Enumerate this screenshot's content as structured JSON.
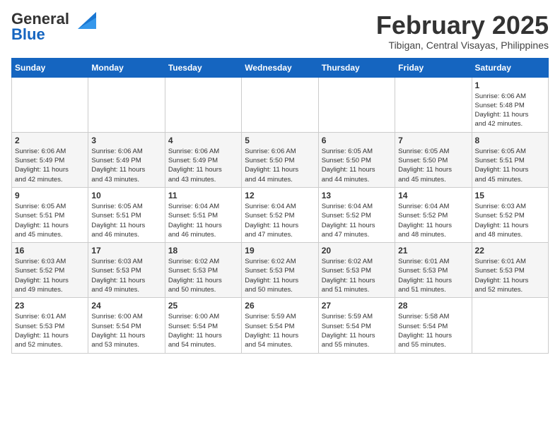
{
  "header": {
    "logo_general": "General",
    "logo_blue": "Blue",
    "month_title": "February 2025",
    "location": "Tibigan, Central Visayas, Philippines"
  },
  "weekdays": [
    "Sunday",
    "Monday",
    "Tuesday",
    "Wednesday",
    "Thursday",
    "Friday",
    "Saturday"
  ],
  "weeks": [
    [
      {
        "day": "",
        "info": ""
      },
      {
        "day": "",
        "info": ""
      },
      {
        "day": "",
        "info": ""
      },
      {
        "day": "",
        "info": ""
      },
      {
        "day": "",
        "info": ""
      },
      {
        "day": "",
        "info": ""
      },
      {
        "day": "1",
        "info": "Sunrise: 6:06 AM\nSunset: 5:48 PM\nDaylight: 11 hours\nand 42 minutes."
      }
    ],
    [
      {
        "day": "2",
        "info": "Sunrise: 6:06 AM\nSunset: 5:49 PM\nDaylight: 11 hours\nand 42 minutes."
      },
      {
        "day": "3",
        "info": "Sunrise: 6:06 AM\nSunset: 5:49 PM\nDaylight: 11 hours\nand 43 minutes."
      },
      {
        "day": "4",
        "info": "Sunrise: 6:06 AM\nSunset: 5:49 PM\nDaylight: 11 hours\nand 43 minutes."
      },
      {
        "day": "5",
        "info": "Sunrise: 6:06 AM\nSunset: 5:50 PM\nDaylight: 11 hours\nand 44 minutes."
      },
      {
        "day": "6",
        "info": "Sunrise: 6:05 AM\nSunset: 5:50 PM\nDaylight: 11 hours\nand 44 minutes."
      },
      {
        "day": "7",
        "info": "Sunrise: 6:05 AM\nSunset: 5:50 PM\nDaylight: 11 hours\nand 45 minutes."
      },
      {
        "day": "8",
        "info": "Sunrise: 6:05 AM\nSunset: 5:51 PM\nDaylight: 11 hours\nand 45 minutes."
      }
    ],
    [
      {
        "day": "9",
        "info": "Sunrise: 6:05 AM\nSunset: 5:51 PM\nDaylight: 11 hours\nand 45 minutes."
      },
      {
        "day": "10",
        "info": "Sunrise: 6:05 AM\nSunset: 5:51 PM\nDaylight: 11 hours\nand 46 minutes."
      },
      {
        "day": "11",
        "info": "Sunrise: 6:04 AM\nSunset: 5:51 PM\nDaylight: 11 hours\nand 46 minutes."
      },
      {
        "day": "12",
        "info": "Sunrise: 6:04 AM\nSunset: 5:52 PM\nDaylight: 11 hours\nand 47 minutes."
      },
      {
        "day": "13",
        "info": "Sunrise: 6:04 AM\nSunset: 5:52 PM\nDaylight: 11 hours\nand 47 minutes."
      },
      {
        "day": "14",
        "info": "Sunrise: 6:04 AM\nSunset: 5:52 PM\nDaylight: 11 hours\nand 48 minutes."
      },
      {
        "day": "15",
        "info": "Sunrise: 6:03 AM\nSunset: 5:52 PM\nDaylight: 11 hours\nand 48 minutes."
      }
    ],
    [
      {
        "day": "16",
        "info": "Sunrise: 6:03 AM\nSunset: 5:52 PM\nDaylight: 11 hours\nand 49 minutes."
      },
      {
        "day": "17",
        "info": "Sunrise: 6:03 AM\nSunset: 5:53 PM\nDaylight: 11 hours\nand 49 minutes."
      },
      {
        "day": "18",
        "info": "Sunrise: 6:02 AM\nSunset: 5:53 PM\nDaylight: 11 hours\nand 50 minutes."
      },
      {
        "day": "19",
        "info": "Sunrise: 6:02 AM\nSunset: 5:53 PM\nDaylight: 11 hours\nand 50 minutes."
      },
      {
        "day": "20",
        "info": "Sunrise: 6:02 AM\nSunset: 5:53 PM\nDaylight: 11 hours\nand 51 minutes."
      },
      {
        "day": "21",
        "info": "Sunrise: 6:01 AM\nSunset: 5:53 PM\nDaylight: 11 hours\nand 51 minutes."
      },
      {
        "day": "22",
        "info": "Sunrise: 6:01 AM\nSunset: 5:53 PM\nDaylight: 11 hours\nand 52 minutes."
      }
    ],
    [
      {
        "day": "23",
        "info": "Sunrise: 6:01 AM\nSunset: 5:53 PM\nDaylight: 11 hours\nand 52 minutes."
      },
      {
        "day": "24",
        "info": "Sunrise: 6:00 AM\nSunset: 5:54 PM\nDaylight: 11 hours\nand 53 minutes."
      },
      {
        "day": "25",
        "info": "Sunrise: 6:00 AM\nSunset: 5:54 PM\nDaylight: 11 hours\nand 54 minutes."
      },
      {
        "day": "26",
        "info": "Sunrise: 5:59 AM\nSunset: 5:54 PM\nDaylight: 11 hours\nand 54 minutes."
      },
      {
        "day": "27",
        "info": "Sunrise: 5:59 AM\nSunset: 5:54 PM\nDaylight: 11 hours\nand 55 minutes."
      },
      {
        "day": "28",
        "info": "Sunrise: 5:58 AM\nSunset: 5:54 PM\nDaylight: 11 hours\nand 55 minutes."
      },
      {
        "day": "",
        "info": ""
      }
    ]
  ]
}
